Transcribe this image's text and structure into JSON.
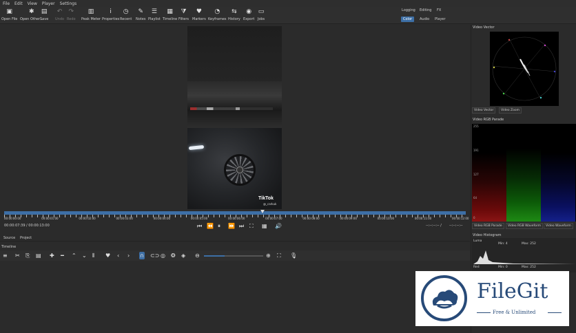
{
  "menu": [
    "File",
    "Edit",
    "View",
    "Player",
    "Settings"
  ],
  "toolbar": [
    {
      "label": "Open File",
      "icon": "folder-icon",
      "glyph": "▣",
      "enabled": true
    },
    {
      "label": "Open Other...",
      "icon": "open-other-icon",
      "glyph": "✱",
      "enabled": true
    },
    {
      "label": "Save",
      "icon": "save-icon",
      "glyph": "▤",
      "enabled": true
    },
    {
      "label": "Undo",
      "icon": "undo-icon",
      "glyph": "↶",
      "enabled": false
    },
    {
      "label": "Redo",
      "icon": "redo-icon",
      "glyph": "↷",
      "enabled": false
    },
    {
      "label": "Peak Meter",
      "icon": "peak-meter-icon",
      "glyph": "▥",
      "enabled": true
    },
    {
      "label": "Properties",
      "icon": "info-icon",
      "glyph": "i",
      "enabled": true
    },
    {
      "label": "Recent",
      "icon": "recent-icon",
      "glyph": "◷",
      "enabled": true
    },
    {
      "label": "Notes",
      "icon": "notes-icon",
      "glyph": "✎",
      "enabled": true
    },
    {
      "label": "Playlist",
      "icon": "playlist-icon",
      "glyph": "☰",
      "enabled": true
    },
    {
      "label": "Timeline",
      "icon": "timeline-icon",
      "glyph": "▦",
      "enabled": true
    },
    {
      "label": "Filters",
      "icon": "filter-icon",
      "glyph": "⧩",
      "enabled": true
    },
    {
      "label": "Markers",
      "icon": "marker-icon",
      "glyph": "♥",
      "enabled": true
    },
    {
      "label": "Keyframes",
      "icon": "keyframes-icon",
      "glyph": "◔",
      "enabled": true
    },
    {
      "label": "History",
      "icon": "history-icon",
      "glyph": "⇆",
      "enabled": true
    },
    {
      "label": "Export",
      "icon": "export-icon",
      "glyph": "◉",
      "enabled": true
    },
    {
      "label": "Jobs",
      "icon": "jobs-icon",
      "glyph": "▭",
      "enabled": true
    }
  ],
  "layouts": {
    "top": [
      "Logging",
      "Editing",
      "FX"
    ],
    "bottom": [
      "Color",
      "Audio",
      "Player"
    ],
    "active": "Color"
  },
  "video": {
    "watermark": "TikTok",
    "handle": "@_carkuk"
  },
  "scrubber": {
    "times": [
      "00:00:00:00",
      "00:00:01:00",
      "00:00:02:00",
      "00:00:03:00",
      "00:00:04:00",
      "00:00:05:00",
      "00:00:06:00",
      "00:00:07:00",
      "00:00:08:00",
      "00:00:09:00",
      "00:00:10:00",
      "00:00:11:00",
      "00:00:12:00"
    ],
    "playhead_fraction": 0.56
  },
  "transport": {
    "position": "00:00:07:39",
    "duration": "/ 00:00:13:00",
    "in_point": "--:--:--:-- /",
    "out_point": "--:--:--:--"
  },
  "source_tabs": [
    "Source",
    "Project"
  ],
  "timeline": {
    "title": "Timeline",
    "tools": [
      {
        "name": "menu-icon",
        "glyph": "≡"
      },
      {
        "name": "cut-icon",
        "glyph": "✂"
      },
      {
        "name": "copy-icon",
        "glyph": "⎘"
      },
      {
        "name": "paste-icon",
        "glyph": "▤"
      },
      {
        "name": "append-icon",
        "glyph": "✚"
      },
      {
        "name": "remove-icon",
        "glyph": "━"
      },
      {
        "name": "lift-icon",
        "glyph": "⌃"
      },
      {
        "name": "overwrite-icon",
        "glyph": "⌄"
      },
      {
        "name": "split-icon",
        "glyph": "⫴"
      },
      {
        "name": "marker-icon",
        "glyph": "♥"
      },
      {
        "name": "previous-marker-icon",
        "glyph": "‹"
      },
      {
        "name": "next-marker-icon",
        "glyph": "›"
      },
      {
        "name": "snap-icon",
        "glyph": "∩",
        "toggled": true
      },
      {
        "name": "scrub-icon",
        "glyph": "⊂⊃"
      },
      {
        "name": "ripple-icon",
        "glyph": "◎"
      },
      {
        "name": "ripple-all-icon",
        "glyph": "❂"
      },
      {
        "name": "ripple-markers-icon",
        "glyph": "◈"
      }
    ],
    "zoom_fraction": 0.35
  },
  "right_panel": {
    "vector_title": "Video Vector",
    "vector_tabs": [
      "Video Vector",
      "Video Zoom"
    ],
    "parade_title": "Video RGB Parade",
    "parade_labels": [
      "255",
      "191",
      "127",
      "64",
      "0"
    ],
    "parade_tabs": [
      "Video RGB Parade",
      "Video RGB Waveform",
      "Video Waveform"
    ],
    "histogram_title": "Video Histogram",
    "luma_label": "Luma",
    "luma_min": "Min: 4",
    "luma_max": "Max: 252",
    "red_label": "Red",
    "red_min": "Min: 0",
    "red_max": "Max: 252"
  },
  "watermark": {
    "name": "FileGit",
    "tagline": "Free & Unlimited",
    "color": "#274a78"
  },
  "colors": {
    "accent": "#3d6fa6",
    "background": "#2b2b2b"
  }
}
